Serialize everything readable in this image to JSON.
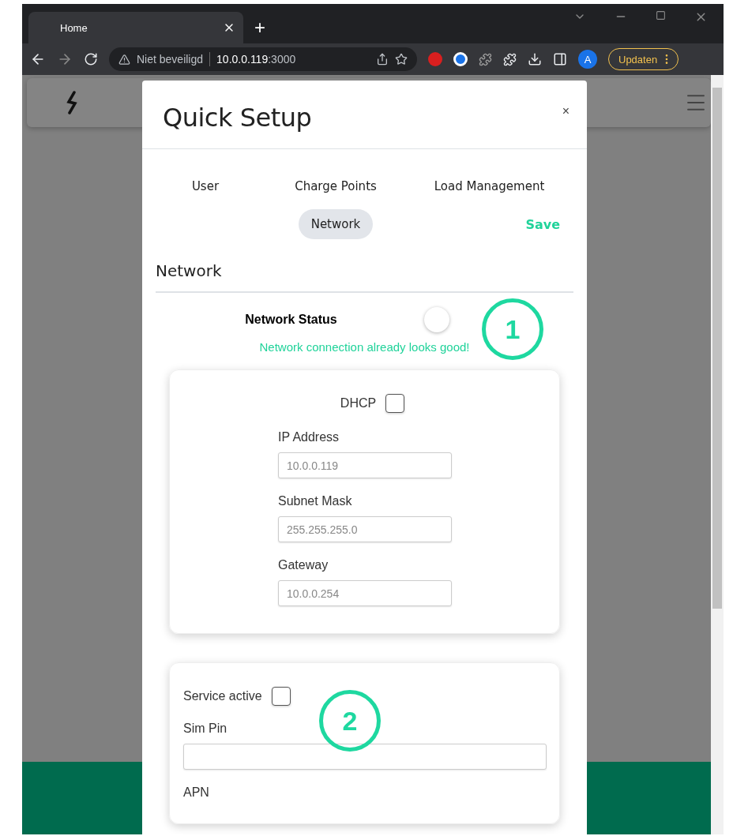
{
  "browser": {
    "tab_title": "Home",
    "new_tab": "+",
    "security_label": "Niet beveiligd",
    "url_host": "10.0.0.119",
    "url_port": ":3000",
    "profile_initial": "A",
    "update_button": "Updaten"
  },
  "modal": {
    "title": "Quick Setup",
    "close": "×",
    "steps": [
      {
        "label": "User",
        "selected": false
      },
      {
        "label": "Charge Points",
        "selected": false
      },
      {
        "label": "Load Management",
        "selected": false
      },
      {
        "label": "Network",
        "selected": true
      }
    ],
    "save": "Save",
    "section_title": "Network",
    "network_status": {
      "label": "Network Status",
      "on": false,
      "message": "Network connection already looks good!"
    },
    "dhcp": {
      "label": "DHCP",
      "checked": false
    },
    "ip_fields": [
      {
        "label": "IP Address",
        "value": "10.0.0.119"
      },
      {
        "label": "Subnet Mask",
        "value": "255.255.255.0"
      },
      {
        "label": "Gateway",
        "value": "10.0.0.254"
      }
    ],
    "service_active": {
      "label": "Service active",
      "checked": false
    },
    "sim_pin": {
      "label": "Sim Pin"
    },
    "apn": {
      "label": "APN"
    }
  },
  "annotations": [
    "1",
    "2"
  ]
}
